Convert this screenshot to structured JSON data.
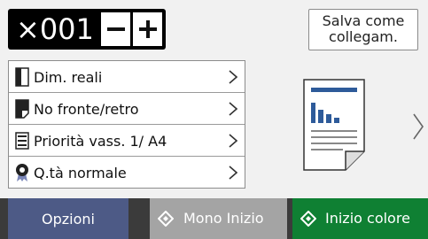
{
  "copies": {
    "prefix": "×",
    "count": "001"
  },
  "shortcut": {
    "line1": "Salva come",
    "line2": "collegam."
  },
  "settings": [
    {
      "icon": "page-size-icon",
      "label": "Dim. reali"
    },
    {
      "icon": "duplex-icon",
      "label": "No fronte/retro"
    },
    {
      "icon": "tray-priority-icon",
      "label": "Priorità vass. 1/ A4"
    },
    {
      "icon": "quality-icon",
      "label": "Q.tà normale"
    }
  ],
  "footer": {
    "options_label": "Opzioni",
    "mono_label": "Mono Inizio",
    "color_label": "Inizio colore"
  },
  "colors": {
    "options_bg": "#4d5a86",
    "mono_bg": "#a4a4a4",
    "color_bg": "#0f8033",
    "accent_blue": "#2e5b9a"
  }
}
